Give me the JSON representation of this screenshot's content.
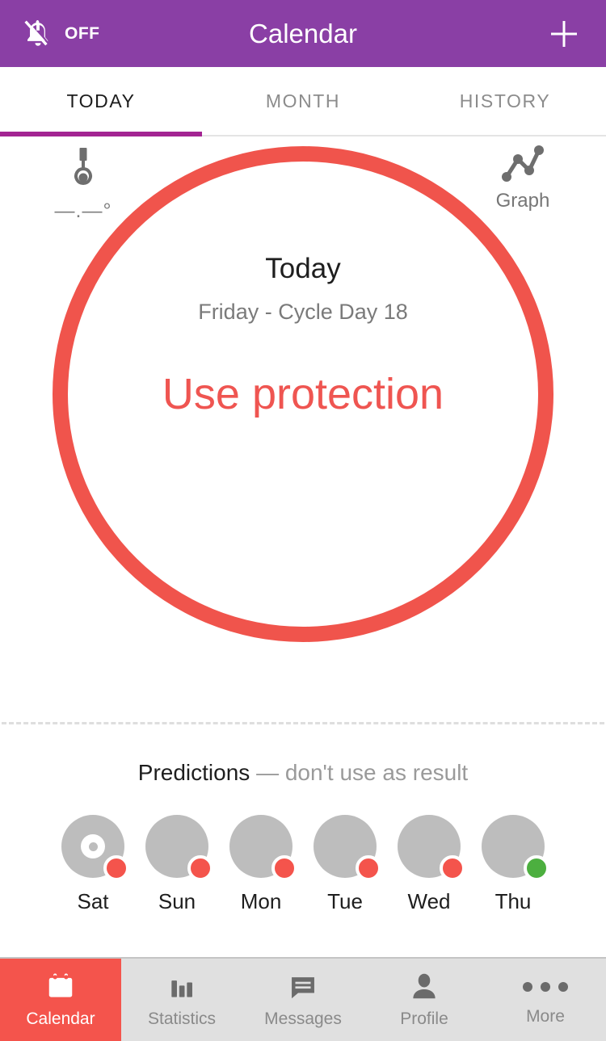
{
  "header": {
    "bell_icon": "bell-off-icon",
    "bell_label": "OFF",
    "title": "Calendar",
    "add_icon": "plus-icon"
  },
  "tabs": [
    {
      "label": "TODAY",
      "active": true
    },
    {
      "label": "MONTH",
      "active": false
    },
    {
      "label": "HISTORY",
      "active": false
    }
  ],
  "main": {
    "temperature": {
      "icon": "thermometer-icon",
      "value": "—.—°"
    },
    "graph": {
      "icon": "line-graph-icon",
      "label": "Graph"
    },
    "ring": {
      "title": "Today",
      "subtitle": "Friday - Cycle Day 18",
      "status": "Use protection",
      "stroke_color": "#f0544c",
      "status_color": "#ef5551"
    }
  },
  "predictions": {
    "title": "Predictions",
    "title_muted": "— don't use as result",
    "days": [
      {
        "label": "Sat",
        "badge_color": "#f4544c",
        "marker": true
      },
      {
        "label": "Sun",
        "badge_color": "#f4544c",
        "marker": false
      },
      {
        "label": "Mon",
        "badge_color": "#f4544c",
        "marker": false
      },
      {
        "label": "Tue",
        "badge_color": "#f4544c",
        "marker": false
      },
      {
        "label": "Wed",
        "badge_color": "#f4544c",
        "marker": false
      },
      {
        "label": "Thu",
        "badge_color": "#4caf3f",
        "marker": false
      }
    ]
  },
  "bottom_nav": [
    {
      "label": "Calendar",
      "icon": "calendar-icon",
      "active": true
    },
    {
      "label": "Statistics",
      "icon": "bar-chart-icon",
      "active": false
    },
    {
      "label": "Messages",
      "icon": "chat-bubble-icon",
      "active": false
    },
    {
      "label": "Profile",
      "icon": "person-icon",
      "active": false
    },
    {
      "label": "More",
      "icon": "ellipsis-icon",
      "active": false
    }
  ],
  "colors": {
    "header_purple": "#8a3fa5",
    "tab_indicator": "#a32492",
    "accent_red": "#f4544c",
    "accent_green": "#4caf3f",
    "prediction_gray": "#bdbdbd",
    "nav_background": "#e0e0e0"
  }
}
